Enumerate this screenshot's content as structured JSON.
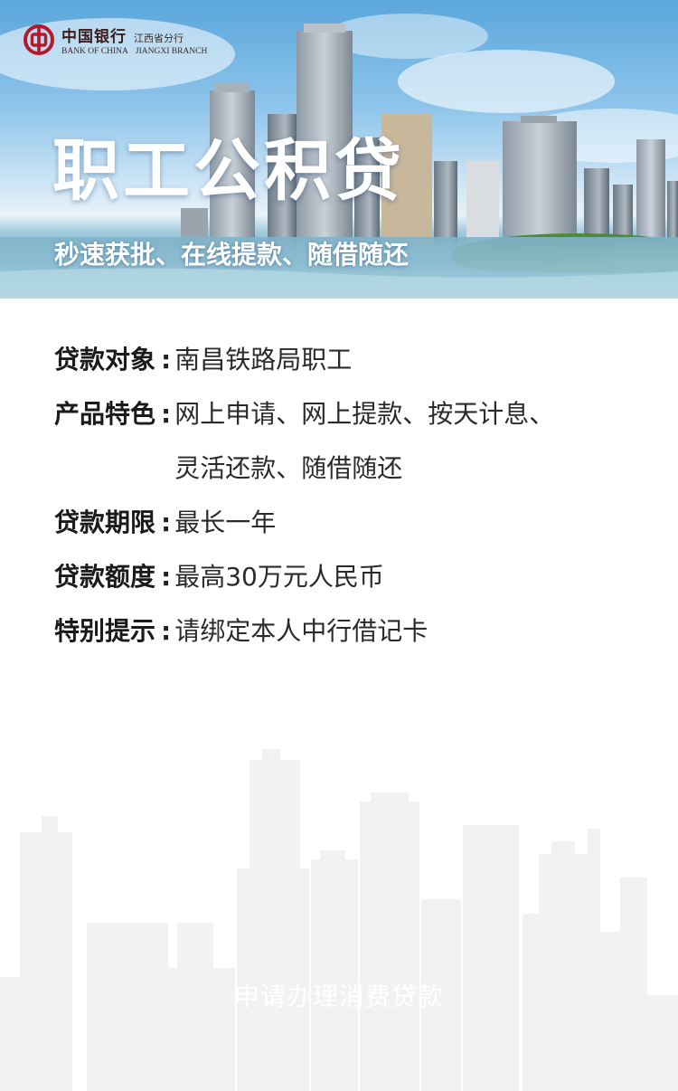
{
  "brand": {
    "name_cn": "中国银行",
    "branch_cn": "江西省分行",
    "name_en": "BANK OF CHINA",
    "branch_en": "JIANGXI BRANCH",
    "color": "#b5172b"
  },
  "banner": {
    "title": "职工公积贷",
    "subtitle": "秒速获批、在线提款、随借随还"
  },
  "details": [
    {
      "label": "贷款对象",
      "lines": [
        "南昌铁路局职工"
      ]
    },
    {
      "label": "产品特色",
      "lines": [
        "网上申请、网上提款、按天计息、",
        "灵活还款、随借随还"
      ]
    },
    {
      "label": "贷款期限",
      "lines": [
        "最长一年"
      ]
    },
    {
      "label": "贷款额度",
      "lines": [
        "最高30万元人民币"
      ]
    },
    {
      "label": "特别提示",
      "lines": [
        "请绑定本人中行借记卡"
      ]
    }
  ],
  "colon": ":",
  "apply": {
    "label": "申请办理消费贷款"
  }
}
